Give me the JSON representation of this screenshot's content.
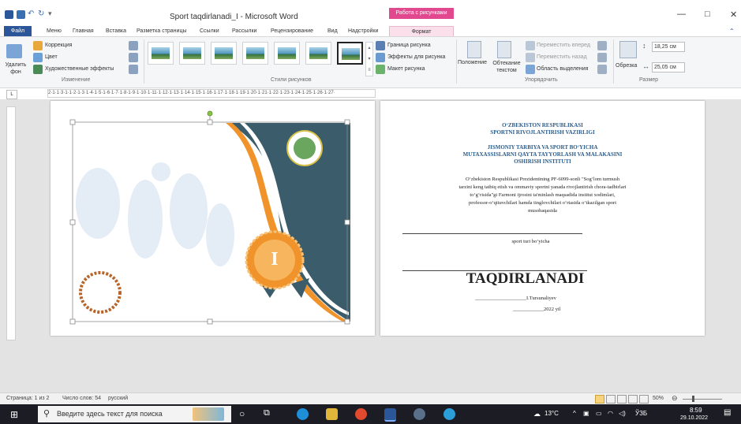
{
  "window": {
    "title": "Sport taqdirlanadi_I - Microsoft Word",
    "context_tab_header": "Работа с рисунками",
    "minimize": "—",
    "maximize": "□",
    "close": "✕"
  },
  "tabs": [
    "Файл",
    "Меню",
    "Главная",
    "Вставка",
    "Разметка страницы",
    "Ссылки",
    "Рассылки",
    "Рецензирование",
    "Вид",
    "Надстройки",
    "Формат"
  ],
  "ribbon": {
    "remove_bg": "Удалить фон",
    "correction": "Коррекция",
    "color": "Цвет",
    "art_effects": "Художественные эффекты",
    "group_change": "Изменение",
    "group_styles": "Стили рисунков",
    "border": "Граница рисунка",
    "effects": "Эффекты для рисунка",
    "layout": "Макет рисунка",
    "position": "Положение",
    "wrap": "Обтекание текстом",
    "bring_forward": "Переместить вперед",
    "send_backward": "Переместить назад",
    "selection_pane": "Область выделения",
    "group_arrange": "Упорядочить",
    "crop": "Обрезка",
    "height": "18,25 см",
    "width": "25,05 см",
    "group_size": "Размер"
  },
  "ruler_text": "2·1·1·3·1·1·2·1·3·1·4·1·5·1·6·1·7·1·8·1·9·1·10·1·11·1·12·1·13·1·14·1·15·1·16·1·17·1·18·1·19·1·20·1·21·1·22·1·23·1·24·1·25·1·26·1·27·",
  "certificate": {
    "medal_text": "I",
    "line1": "O‘ZBEKISTON RESPUBLIKASI",
    "line2": "SPORTNI RIVOJLANTIRISH VAZIRLIGI",
    "line3": "JISMONIY TARBIYA VA SPORT BO‘YICHA",
    "line4": "MUTAXASSISLARNI QAYTA TAYYORLASH VA MALAKASINI",
    "line5": "OSHIRISH INSTITUTI",
    "body1": "O‘zbekiston Respublikasi Prezidentining PF-6099-sonli \"Sog‘lom turmush",
    "body2": "tarzini keng tatbiq etish va ommaviy sportni yanada rivojlantirish chora-tadbirlari",
    "body3": "to‘g‘risida\"gi Farmoni ijrosini ta'minlash maqsadida institut xodimlari,",
    "body4": "professor-o‘qituvchilari hamda tinglovchilari o‘rtasida o‘tkazilgan sport",
    "body5": "musobaqasida",
    "sport_type": "sport turi bo‘yicha",
    "heading": "TAQDIRLANADI",
    "signature": "____________________I.Tursunaliyev",
    "date": "____________2022 yil"
  },
  "status": {
    "page": "Страница: 1 из 2",
    "words": "Число слов: 54",
    "lang": "русский",
    "zoom": "50%"
  },
  "taskbar": {
    "search_placeholder": "Введите здесь текст для поиска",
    "temperature": "13°C",
    "lang": "ЎЗБ",
    "time": "8:59",
    "date": "29.10.2022"
  }
}
